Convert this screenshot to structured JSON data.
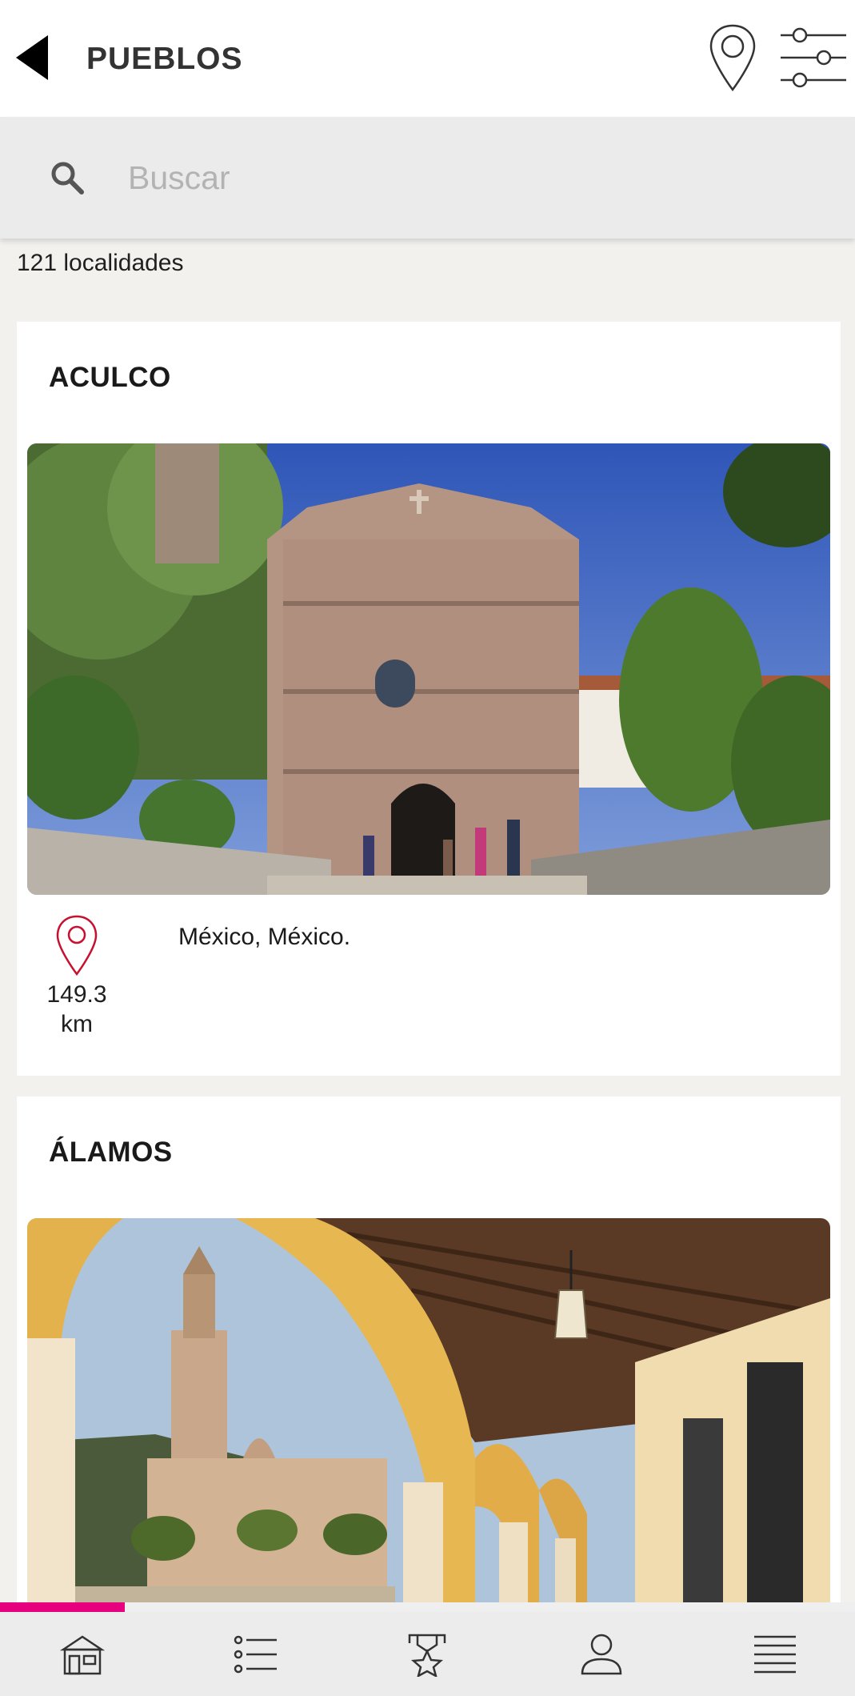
{
  "header": {
    "title": "PUEBLOS",
    "back_icon": "back-arrow-icon",
    "map_icon": "map-pin-icon",
    "filter_icon": "sliders-icon"
  },
  "search": {
    "placeholder": "Buscar",
    "value": ""
  },
  "results": {
    "count_label": "121 localidades"
  },
  "towns": [
    {
      "name": "ACULCO",
      "region": "México, México.",
      "distance_value": "149.3",
      "distance_unit": "km",
      "photo": "church-plaza-photo"
    },
    {
      "name": "ÁLAMOS",
      "photo": "arcade-church-photo"
    }
  ],
  "progress": {
    "fraction": 0.146,
    "color": "#e6007e"
  },
  "tabs": [
    {
      "name": "tab-home",
      "icon": "town-hall-icon"
    },
    {
      "name": "tab-list",
      "icon": "list-icon"
    },
    {
      "name": "tab-badges",
      "icon": "medal-icon"
    },
    {
      "name": "tab-profile",
      "icon": "user-icon"
    },
    {
      "name": "tab-menu",
      "icon": "menu-icon"
    }
  ],
  "colors": {
    "accent": "#e6007e",
    "pin_red": "#c8102e",
    "background": "#f2f1ee"
  }
}
